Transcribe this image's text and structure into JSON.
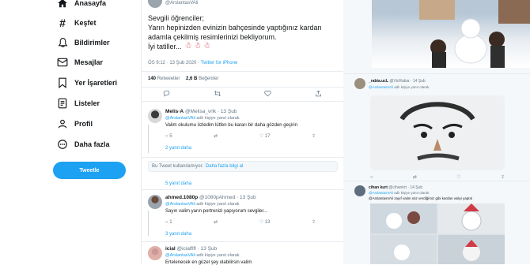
{
  "nav": {
    "items": [
      {
        "label": "Anasayfa",
        "icon": "home-icon"
      },
      {
        "label": "Keşfet",
        "icon": "hashtag-icon"
      },
      {
        "label": "Bildirimler",
        "icon": "bell-icon"
      },
      {
        "label": "Mesajlar",
        "icon": "mail-icon"
      },
      {
        "label": "Yer İşaretleri",
        "icon": "bookmark-icon"
      },
      {
        "label": "Listeler",
        "icon": "list-icon"
      },
      {
        "label": "Profil",
        "icon": "profile-icon"
      },
      {
        "label": "Daha fazla",
        "icon": "more-icon"
      }
    ],
    "tweet_button": "Tweetle"
  },
  "main_tweet": {
    "handle": "@ArslantasVAli",
    "lines": [
      "Sevgili öğrenciler;",
      "Yarın hepinizden evinizin bahçesinde yaptığınız kardan",
      "adamla çekilmiş resimlerinizi bekliyorum.",
      "İyi tatiller..."
    ],
    "emoji": "☃ ☃ ☃",
    "time": "ÖS 9:12 · 13 Şub 2020 · ",
    "source": "Twitter for iPhone",
    "retweets_count": "140",
    "retweets_label": "Retweetler",
    "likes_count": "2,6 B",
    "likes_label": "Beğeniler"
  },
  "replies": [
    {
      "name": "Melis·A",
      "handle": "@Melisa_vrlk · 13 Şub",
      "replying": "@ArslantasVAli",
      "replying_suffix": "adlı kişiye yanıt olarak",
      "text": "Valim okulumu özledim lütfen bu kararı bir daha gözden geçirin",
      "replies": "5",
      "likes": "17",
      "more": "2 yanıt daha"
    },
    {
      "name": "ahmed.1080p",
      "handle": "@1080pAhmed · 13 Şub",
      "replying": "@ArslantasVAli",
      "replying_suffix": "adlı kişiye yanıt olarak",
      "text": "Sayın valim yarın portrenizi yapıyorum sevgiler...",
      "replies": "1",
      "likes": "13",
      "more": "3 yanıt daha"
    },
    {
      "name": "icial",
      "handle": "@icialflfl · 13 Şub",
      "replying": "@ArslantasVAli",
      "replying_suffix": "adlı kişiye yanıt olarak",
      "text": "Ertelenecek en güzel şey olabilirsin valim",
      "replies": "",
      "likes": "",
      "more": ""
    }
  ],
  "notice": {
    "text": "Bu Tweet kullanılamıyor.",
    "link": "Daha fazla bilgi al"
  },
  "more_replies_top": "5 yanıt daha",
  "right": {
    "card1": {
      "name": "_rabia.ucL",
      "handle": "@VicRabia · 14 Şub",
      "replying": "@ArslantasVAli",
      "replying_suffix": "adlı kişiye yanıt olarak"
    },
    "card2": {
      "name": "cihan kurt",
      "handle": "@cihankrt · 14 Şub",
      "replying": "@ArslantasVAli",
      "replying_suffix": "adlı kişiye yanıt olarak",
      "text": "@ArslantasVAli zayıf valim söz verdiğimiz gibi kardan valiyi yaptık"
    }
  },
  "colors": {
    "accent": "#1da1f2",
    "border": "#e6ecf0",
    "muted": "#657786"
  }
}
